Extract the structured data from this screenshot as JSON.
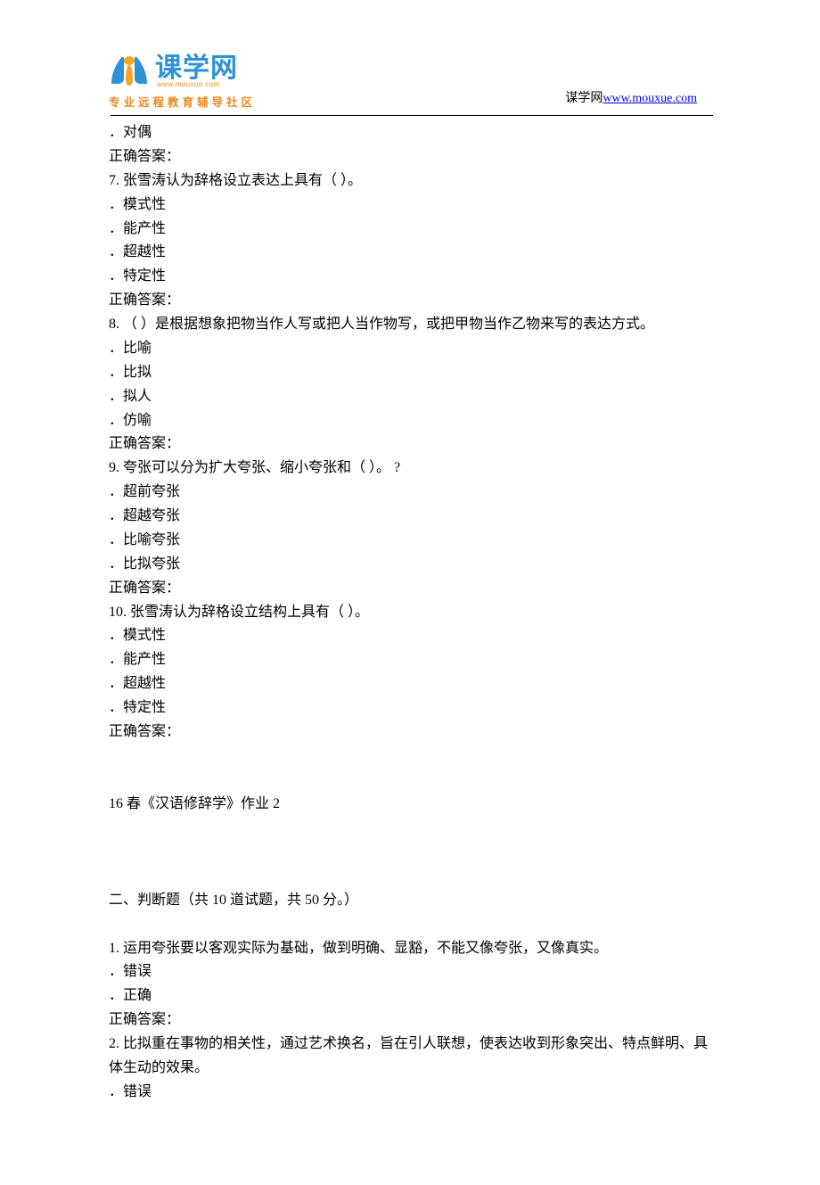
{
  "header": {
    "logo_name": "课学网",
    "logo_sub": "www.mouxue.com",
    "logo_tagline": "专业远程教育辅导社区",
    "site_label": "谋学网",
    "site_url": "www.mouxue.com"
  },
  "prev_tail_option": "．对偶",
  "prev_tail_ans": "正确答案：",
  "q7": {
    "stem": "7.   张雪涛认为辞格设立表达上具有（ ）。",
    "opts": [
      "．模式性",
      "．能产性",
      "．超越性",
      "．特定性"
    ],
    "ans": "正确答案："
  },
  "q8": {
    "stem": "8.  （ ）是根据想象把物当作人写或把人当作物写，或把甲物当作乙物来写的表达方式。",
    "opts": [
      "．比喻",
      "．比拟",
      "．拟人",
      "．仿喻"
    ],
    "ans": "正确答案："
  },
  "q9": {
    "stem": "9.   夸张可以分为扩大夸张、缩小夸张和（ ）。 ?",
    "opts": [
      "．超前夸张",
      "．超越夸张",
      "．比喻夸张",
      "．比拟夸张"
    ],
    "ans": "正确答案："
  },
  "q10": {
    "stem": "10.   张雪涛认为辞格设立结构上具有（ ）。",
    "opts": [
      "．模式性",
      "．能产性",
      "．超越性",
      "．特定性"
    ],
    "ans": "正确答案："
  },
  "section2_title": "16 春《汉语修辞学》作业 2",
  "section2_heading": "二、判断题（共 10 道试题，共 50 分。）",
  "j1": {
    "stem": "1.   运用夸张要以客观实际为基础，做到明确、显豁，不能又像夸张，又像真实。",
    "opts": [
      "．错误",
      "．正确"
    ],
    "ans": "正确答案："
  },
  "j2": {
    "stem": "2.   比拟重在事物的相关性，通过艺术换名，旨在引人联想，使表达收到形象突出、特点鲜明、具体生动的效果。",
    "opts_partial": [
      "．错误"
    ]
  }
}
